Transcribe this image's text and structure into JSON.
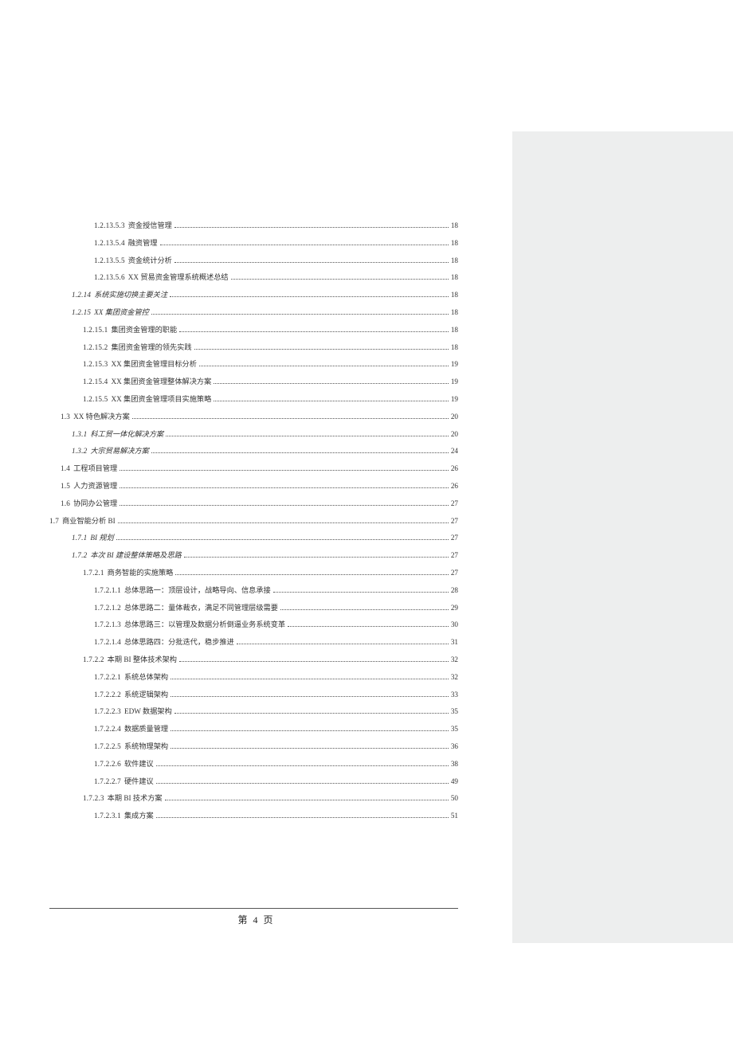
{
  "footer": {
    "prefix": "第",
    "num": "4",
    "suffix": "页"
  },
  "toc": [
    {
      "lvl": 4,
      "num": "1.2.13.5.3",
      "title": "资金授信管理",
      "page": "18",
      "italic": false
    },
    {
      "lvl": 4,
      "num": "1.2.13.5.4",
      "title": "融资管理",
      "page": "18",
      "italic": false
    },
    {
      "lvl": 4,
      "num": "1.2.13.5.5",
      "title": "资金统计分析",
      "page": "18",
      "italic": false
    },
    {
      "lvl": 4,
      "num": "1.2.13.5.6",
      "title": "XX 贸易资金管理系统概述总结",
      "page": "18",
      "italic": false
    },
    {
      "lvl": 2,
      "num": "1.2.14",
      "title": "系统实施切换主要关注",
      "page": "18",
      "italic": true
    },
    {
      "lvl": 2,
      "num": "1.2.15",
      "title": "XX 集团资金管控",
      "page": "18",
      "italic": true
    },
    {
      "lvl": 3,
      "num": "1.2.15.1",
      "title": "集团资金管理的职能",
      "page": "18",
      "italic": false
    },
    {
      "lvl": 3,
      "num": "1.2.15.2",
      "title": "集团资金管理的领先实践",
      "page": "18",
      "italic": false
    },
    {
      "lvl": 3,
      "num": "1.2.15.3",
      "title": "XX 集团资金管理目标分析",
      "page": "19",
      "italic": false
    },
    {
      "lvl": 3,
      "num": "1.2.15.4",
      "title": "XX 集团资金管理整体解决方案",
      "page": "19",
      "italic": false
    },
    {
      "lvl": 3,
      "num": "1.2.15.5",
      "title": "XX 集团资金管理项目实施策略",
      "page": "19",
      "italic": false
    },
    {
      "lvl": 1,
      "num": "1.3",
      "title": "XX 特色解决方案",
      "page": "20",
      "italic": false
    },
    {
      "lvl": 2,
      "num": "1.3.1",
      "title": "科工贸一体化解决方案",
      "page": "20",
      "italic": true
    },
    {
      "lvl": 2,
      "num": "1.3.2",
      "title": "大宗贸易解决方案",
      "page": "24",
      "italic": true
    },
    {
      "lvl": 1,
      "num": "1.4",
      "title": "工程项目管理",
      "page": "26",
      "italic": false
    },
    {
      "lvl": 1,
      "num": "1.5",
      "title": "人力资源管理",
      "page": "26",
      "italic": false
    },
    {
      "lvl": 1,
      "num": "1.6",
      "title": "协同办公管理",
      "page": "27",
      "italic": false
    },
    {
      "lvl": 0,
      "num": "1.7",
      "title": "商业智能分析 BI",
      "page": "27",
      "italic": false
    },
    {
      "lvl": 2,
      "num": "1.7.1",
      "title": "BI 规划",
      "page": "27",
      "italic": true
    },
    {
      "lvl": 2,
      "num": "1.7.2",
      "title": "本次 BI 建设整体策略及思路",
      "page": "27",
      "italic": true
    },
    {
      "lvl": 3,
      "num": "1.7.2.1",
      "title": "商务智能的实施策略",
      "page": "27",
      "italic": false
    },
    {
      "lvl": 4,
      "num": "1.7.2.1.1",
      "title": "总体思路一：顶层设计，战略导向、信息承接",
      "page": "28",
      "italic": false
    },
    {
      "lvl": 4,
      "num": "1.7.2.1.2",
      "title": "总体思路二：量体裁衣，满足不同管理层级需要",
      "page": "29",
      "italic": false
    },
    {
      "lvl": 4,
      "num": "1.7.2.1.3",
      "title": "总体思路三：以管理及数据分析倒逼业务系统变革",
      "page": "30",
      "italic": false
    },
    {
      "lvl": 4,
      "num": "1.7.2.1.4",
      "title": "总体思路四：分批迭代，稳步推进",
      "page": "31",
      "italic": false
    },
    {
      "lvl": 3,
      "num": "1.7.2.2",
      "title": "本期 BI 整体技术架构",
      "page": "32",
      "italic": false
    },
    {
      "lvl": 4,
      "num": "1.7.2.2.1",
      "title": "系统总体架构",
      "page": "32",
      "italic": false
    },
    {
      "lvl": 4,
      "num": "1.7.2.2.2",
      "title": "系统逻辑架构",
      "page": "33",
      "italic": false
    },
    {
      "lvl": 4,
      "num": "1.7.2.2.3",
      "title": "EDW 数据架构",
      "page": "35",
      "italic": false
    },
    {
      "lvl": 4,
      "num": "1.7.2.2.4",
      "title": "数据质量管理",
      "page": "35",
      "italic": false
    },
    {
      "lvl": 4,
      "num": "1.7.2.2.5",
      "title": "系统物理架构",
      "page": "36",
      "italic": false
    },
    {
      "lvl": 4,
      "num": "1.7.2.2.6",
      "title": "软件建议",
      "page": "38",
      "italic": false
    },
    {
      "lvl": 4,
      "num": "1.7.2.2.7",
      "title": "硬件建议",
      "page": "49",
      "italic": false
    },
    {
      "lvl": 3,
      "num": "1.7.2.3",
      "title": "本期 BI 技术方案",
      "page": "50",
      "italic": false
    },
    {
      "lvl": 4,
      "num": "1.7.2.3.1",
      "title": "集成方案",
      "page": "51",
      "italic": false
    }
  ]
}
